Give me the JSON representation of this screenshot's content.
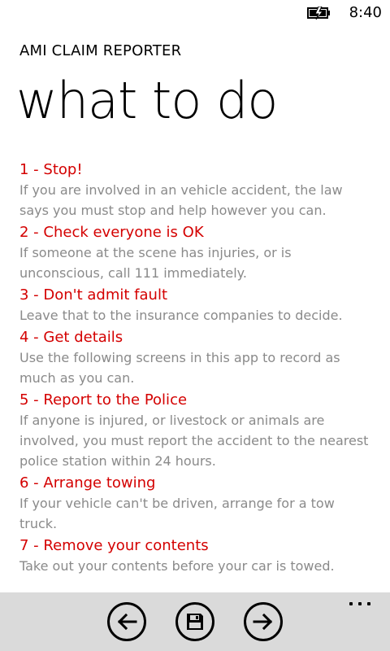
{
  "status_bar": {
    "time": "8:40",
    "battery_icon": "battery-charging-icon"
  },
  "header": {
    "app_title": "AMI CLAIM REPORTER",
    "page_title": "what to do"
  },
  "steps": [
    {
      "heading": "1 - Stop!",
      "body": "If you are involved in an vehicle accident, the law says you must stop and help however you can."
    },
    {
      "heading": "2 - Check everyone is OK",
      "body": "If someone at the scene has injuries, or is unconscious, call 111 immediately."
    },
    {
      "heading": "3 - Don't admit fault",
      "body": "Leave that to the insurance companies to decide."
    },
    {
      "heading": "4 - Get details",
      "body": "Use the following screens in this app to record as much as you can."
    },
    {
      "heading": "5 - Report to the Police",
      "body": "If anyone is injured, or livestock or animals are involved, you must report the accident to the nearest police station within 24 hours."
    },
    {
      "heading": "6 - Arrange towing",
      "body": "If your vehicle can't be driven, arrange for a tow truck."
    },
    {
      "heading": "7 - Remove your contents",
      "body": "Take out your contents before your car is towed."
    }
  ],
  "app_bar": {
    "buttons": [
      {
        "icon": "back-arrow-icon"
      },
      {
        "icon": "save-icon"
      },
      {
        "icon": "forward-arrow-icon"
      }
    ],
    "more_icon": "ellipsis-icon"
  },
  "colors": {
    "heading": "#d40000",
    "body": "#8a8a8a",
    "app_bar_bg": "#dadada"
  }
}
